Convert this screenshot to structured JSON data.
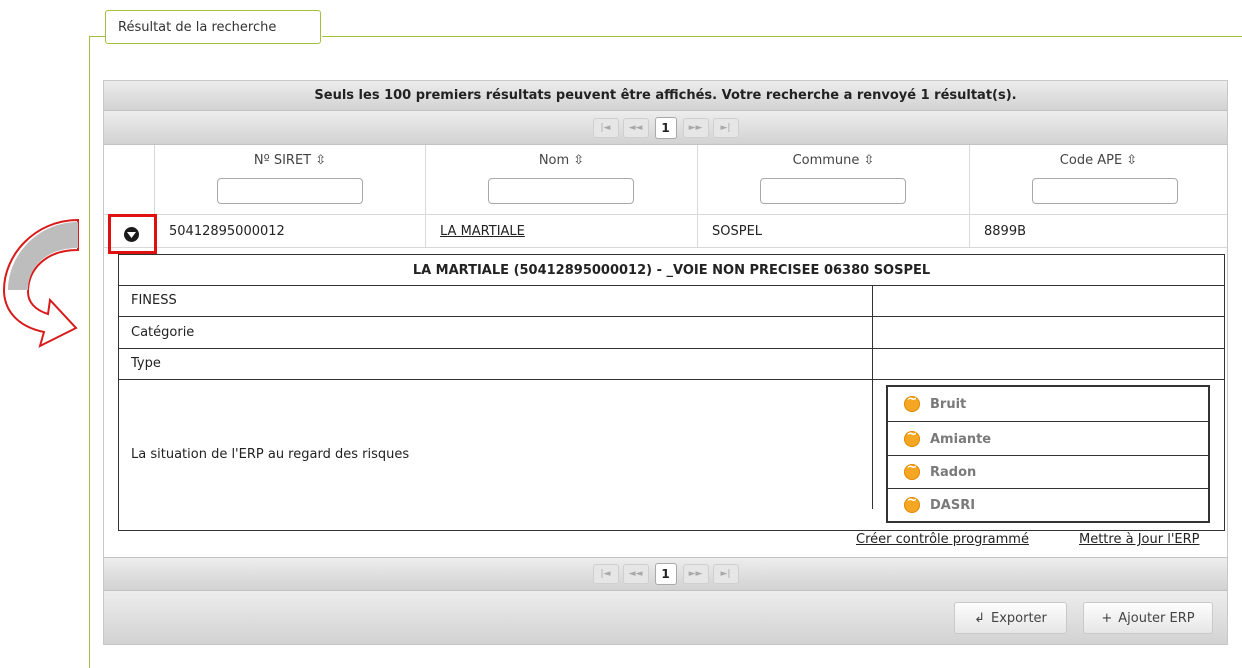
{
  "panel": {
    "legend": "Résultat de la recherche"
  },
  "table": {
    "caption": "Seuls les 100 premiers résultats peuvent être affichés. Votre recherche a renvoyé 1 résultat(s).",
    "pager": {
      "first": "|◄",
      "prev": "◄◄",
      "page": "1",
      "next": "►►",
      "last": "►|"
    },
    "columns": [
      "Nº SIRET ⇳",
      "Nom ⇳",
      "Commune ⇳",
      "Code APE ⇳"
    ],
    "row": {
      "siret": "50412895000012",
      "nom": "LA MARTIALE",
      "commune": "SOSPEL",
      "ape": "8899B"
    }
  },
  "detail": {
    "title": "LA MARTIALE (50412895000012) - _VOIE NON PRECISEE 06380 SOSPEL",
    "fields": [
      "FINESS",
      "Catégorie",
      "Type"
    ],
    "risks_label": "La situation de l'ERP au regard des risques",
    "risks": [
      "Bruit",
      "Amiante",
      "Radon",
      "DASRI"
    ],
    "links": {
      "create": "Créer contrôle programmé",
      "update": "Mettre à Jour l'ERP"
    }
  },
  "footer": {
    "export": "Exporter",
    "export_icon": "↲",
    "add": "Ajouter ERP",
    "add_icon": "+"
  },
  "colors": {
    "frame": "#a2c040",
    "highlight": "#e01010",
    "risk_icon": "#f5a623"
  }
}
